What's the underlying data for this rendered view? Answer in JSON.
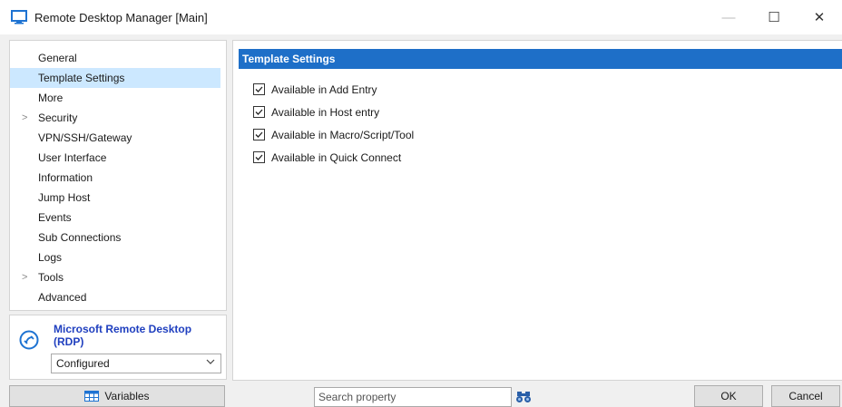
{
  "window": {
    "title": "Remote Desktop Manager [Main]",
    "controls": {
      "minimize": "—",
      "maximize": "☐",
      "close": "✕"
    }
  },
  "nav": {
    "items": [
      {
        "label": "General",
        "selected": false,
        "expandable": false
      },
      {
        "label": "Template Settings",
        "selected": true,
        "expandable": false
      },
      {
        "label": "More",
        "selected": false,
        "expandable": false
      },
      {
        "label": "Security",
        "selected": false,
        "expandable": true
      },
      {
        "label": "VPN/SSH/Gateway",
        "selected": false,
        "expandable": false
      },
      {
        "label": "User Interface",
        "selected": false,
        "expandable": false
      },
      {
        "label": "Information",
        "selected": false,
        "expandable": false
      },
      {
        "label": "Jump Host",
        "selected": false,
        "expandable": false
      },
      {
        "label": "Events",
        "selected": false,
        "expandable": false
      },
      {
        "label": "Sub Connections",
        "selected": false,
        "expandable": false
      },
      {
        "label": "Logs",
        "selected": false,
        "expandable": false
      },
      {
        "label": "Tools",
        "selected": false,
        "expandable": true
      },
      {
        "label": "Advanced",
        "selected": false,
        "expandable": false
      }
    ],
    "chevron_glyph": ">"
  },
  "entry": {
    "name": "Microsoft Remote Desktop (RDP)",
    "status": "Configured"
  },
  "content": {
    "section_title": "Template Settings",
    "checkboxes": [
      {
        "label": "Available in Add Entry",
        "checked": true
      },
      {
        "label": "Available in Host entry",
        "checked": true
      },
      {
        "label": "Available in Macro/Script/Tool",
        "checked": true
      },
      {
        "label": "Available in Quick Connect",
        "checked": true
      }
    ]
  },
  "footer": {
    "variables_label": "Variables",
    "search_placeholder": "Search property",
    "ok_label": "OK",
    "cancel_label": "Cancel"
  },
  "colors": {
    "accent": "#1e6fc8",
    "selection": "#cce8ff",
    "entry_name": "#1f3fbf",
    "icon_blue": "#1e73d2"
  },
  "icons": {
    "app": "monitor-icon",
    "rdp": "rdp-icon",
    "variables": "grid-icon",
    "search": "binoculars-icon",
    "dropdown": "chevron-down-icon",
    "checkbox": "checkmark-icon"
  }
}
